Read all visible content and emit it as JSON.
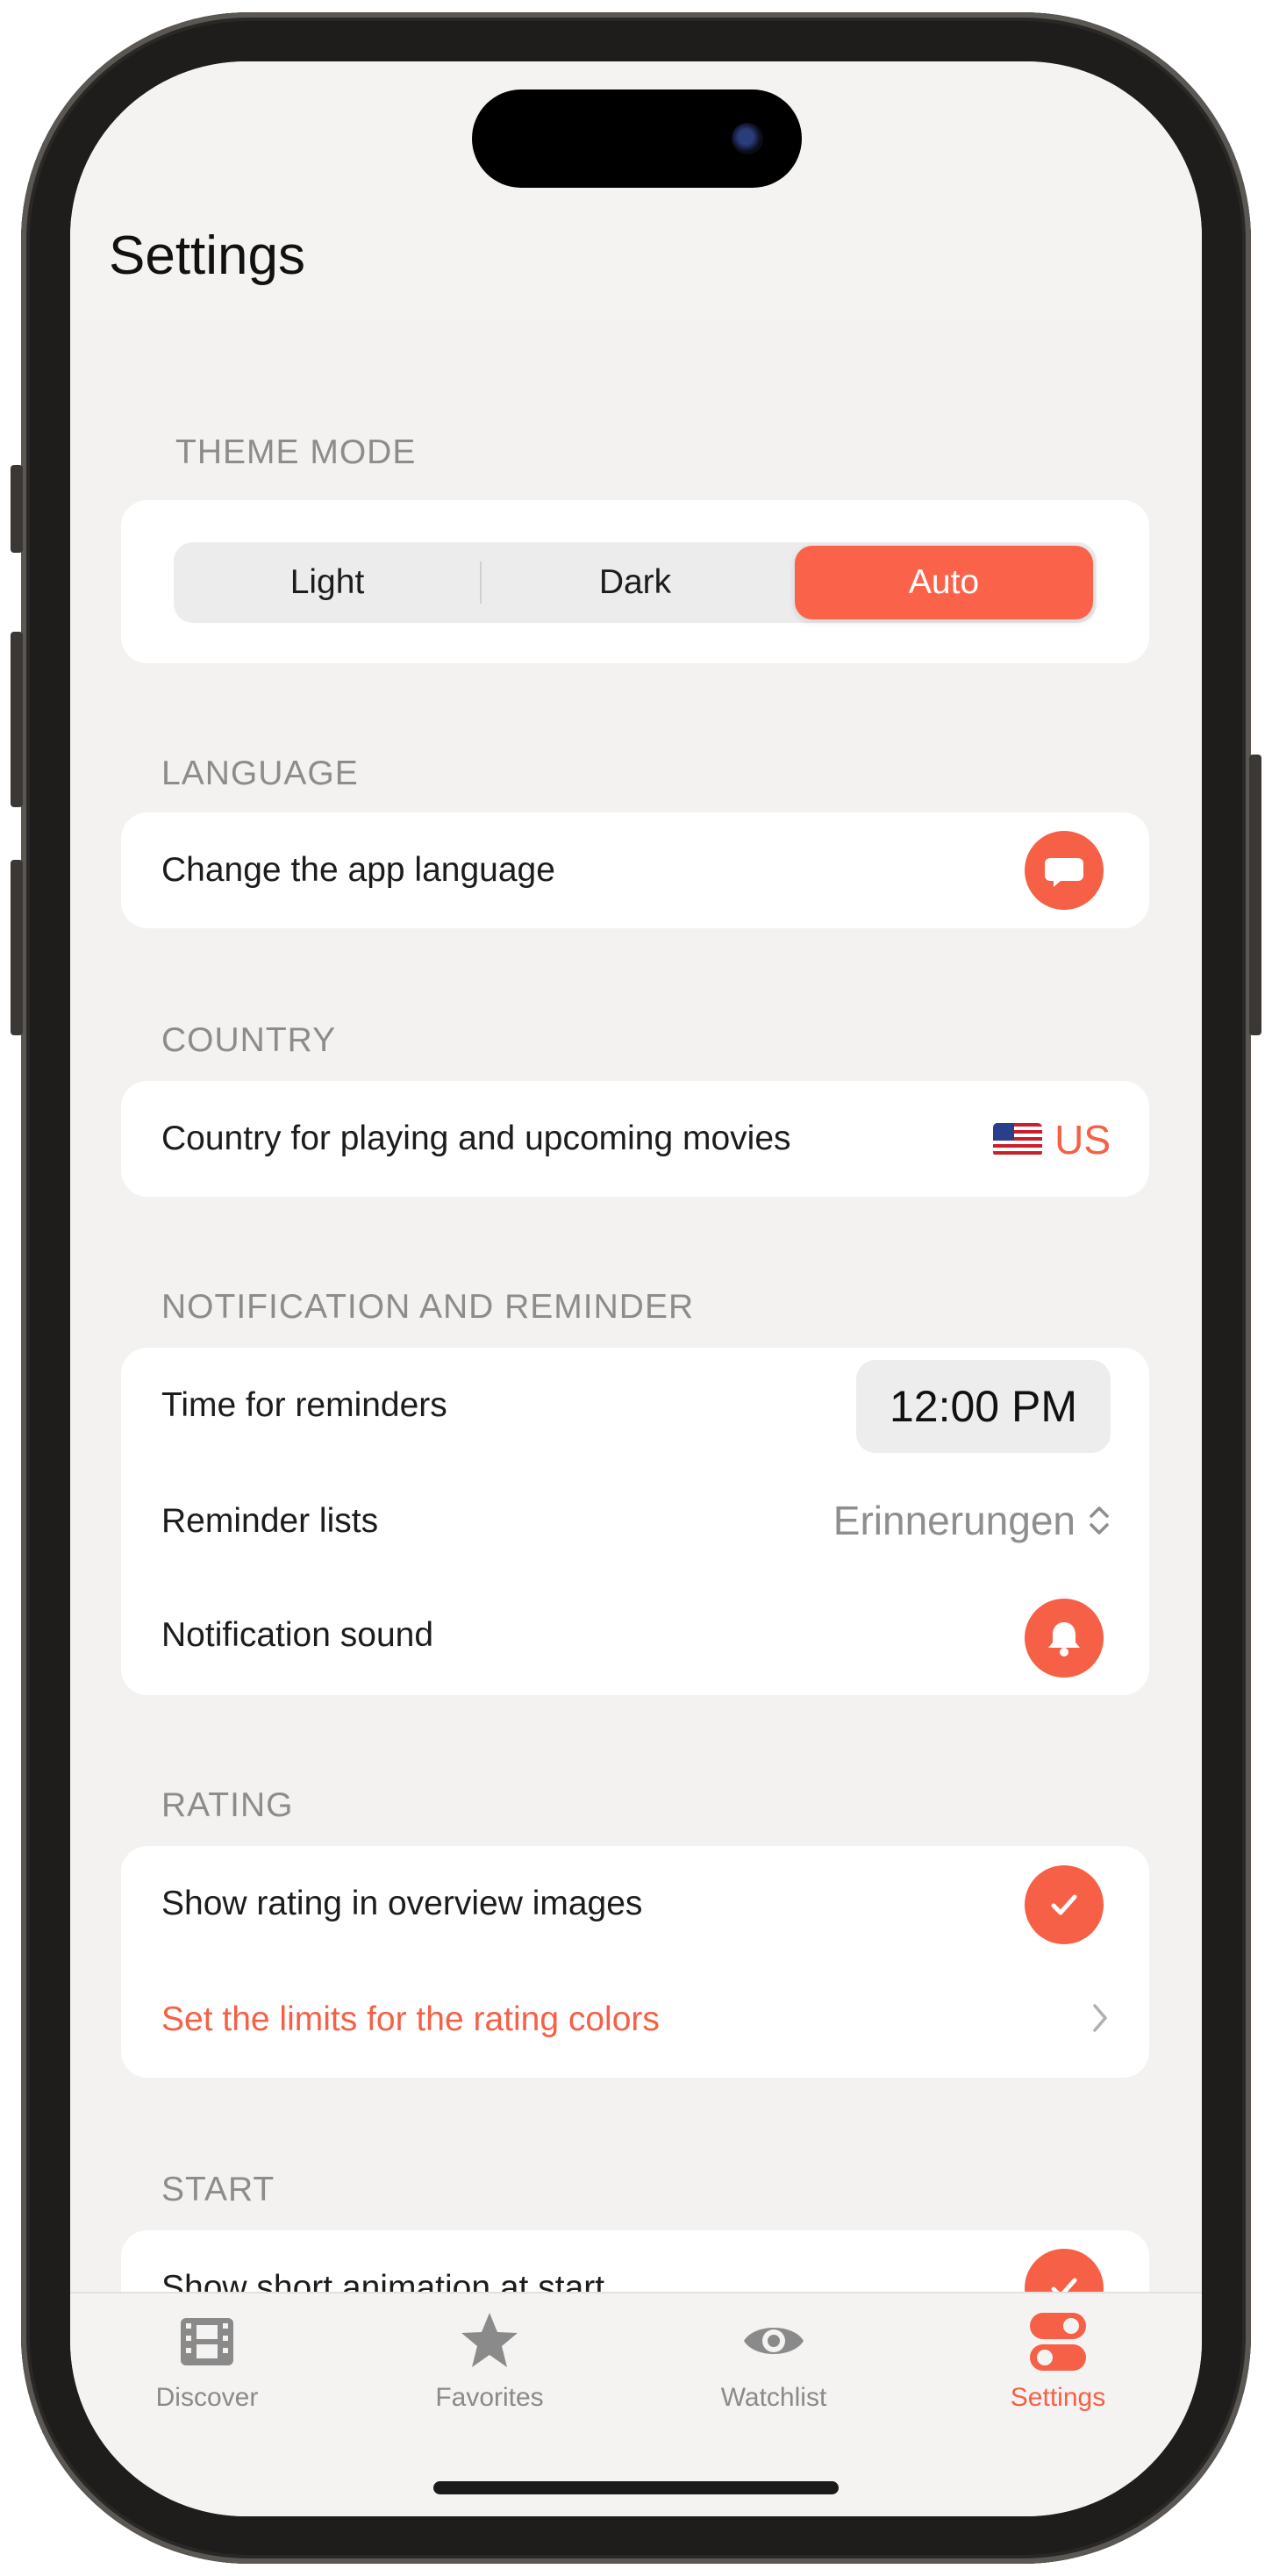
{
  "header": {
    "title": "Settings"
  },
  "theme": {
    "label": "THEME MODE",
    "options": [
      "Light",
      "Dark",
      "Auto"
    ],
    "selected": "Auto"
  },
  "language": {
    "label": "LANGUAGE",
    "row": "Change the app language",
    "icon": "speech-bubble-icon"
  },
  "country": {
    "label": "COUNTRY",
    "row": "Country for playing and upcoming movies",
    "value": "US",
    "flag": "us-flag-icon"
  },
  "notification": {
    "label": "NOTIFICATION AND REMINDER",
    "time_row": "Time for reminders",
    "time_value": "12:00 PM",
    "lists_row": "Reminder lists",
    "lists_value": "Erinnerungen",
    "sound_row": "Notification sound",
    "sound_icon": "bell-icon"
  },
  "rating": {
    "label": "RATING",
    "show_row": "Show rating in overview images",
    "show_checked": true,
    "limits_row": "Set the limits for the rating colors"
  },
  "start": {
    "label": "START",
    "animation_row": "Show short animation at start",
    "animation_checked": true
  },
  "tabbar": {
    "tabs": [
      {
        "label": "Discover",
        "icon": "film-icon"
      },
      {
        "label": "Favorites",
        "icon": "star-icon"
      },
      {
        "label": "Watchlist",
        "icon": "eye-icon"
      },
      {
        "label": "Settings",
        "icon": "toggles-icon"
      }
    ],
    "active": "Settings"
  },
  "colors": {
    "accent": "#f56046",
    "background": "#f3f2f0",
    "card": "#ffffff"
  }
}
